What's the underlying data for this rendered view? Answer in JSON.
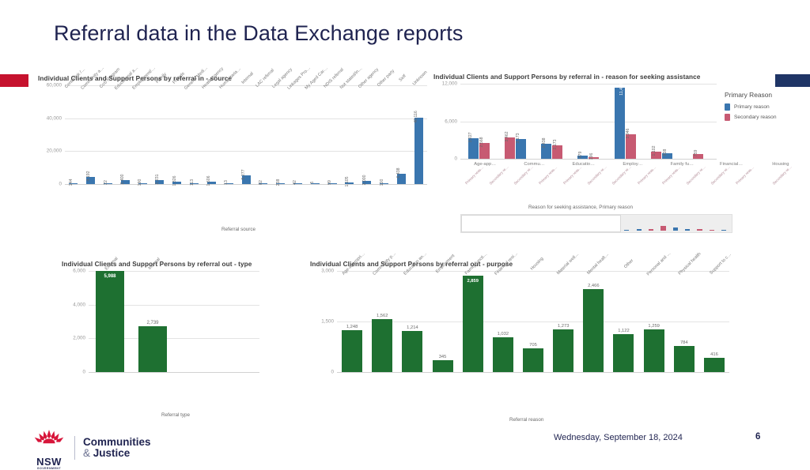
{
  "slide": {
    "title": "Referral data in the Data Exchange reports",
    "page_number": "6",
    "date": "Wednesday, September 18, 2024",
    "accent_red": "#c6122e",
    "accent_navy": "#1f3566"
  },
  "footer": {
    "org_line1": "NSW",
    "org_line2": "GOVERNMENT",
    "dept_line1": "Communities",
    "dept_amp": "&",
    "dept_line2": "Justice"
  },
  "chart_data": [
    {
      "id": "referral-in-source",
      "type": "bar",
      "title": "Individual Clients and Support Persons by referral in - source",
      "xlabel": "Referral source",
      "ylabel": "",
      "ylim": [
        0,
        60000
      ],
      "yticks": [
        "0",
        "20,000",
        "40,000",
        "60,000"
      ],
      "grid": true,
      "color": "#3a76af",
      "categories": [
        "Centrelink /…",
        "Community a…",
        "CoS Program",
        "Educational a…",
        "Employment/…",
        "Family",
        "Friends",
        "General Medi…",
        "Health Agency",
        "Humanitaria…",
        "Internal",
        "LAC referral",
        "Legal agency",
        "Linkages Pro…",
        "My Aged Car…",
        "NDIS referral",
        "Not stated/in…",
        "Other agency",
        "Other party",
        "Self",
        "Unknown"
      ],
      "values": [
        144,
        4192,
        22,
        2400,
        190,
        2231,
        1326,
        113,
        1606,
        13,
        5277,
        82,
        238,
        42,
        5,
        99,
        1105,
        2000,
        100,
        6438,
        40116
      ],
      "value_labels": [
        "144",
        "4,192",
        "22",
        "2,400",
        "190",
        "2,231",
        "1,326",
        "113",
        "1,606",
        "13",
        "5,277",
        "82",
        "238",
        "42",
        "5",
        "99",
        "1,105",
        "2,000",
        "100",
        "6,438",
        "40,116"
      ]
    },
    {
      "id": "referral-in-reason",
      "type": "bar",
      "title": "Individual Clients and Support Persons by referral in - reason for seeking assistance",
      "xlabel": "Reason for seeking assistance, Primary reason",
      "ylabel": "",
      "ylim": [
        0,
        12000
      ],
      "yticks": [
        "0",
        "6,000",
        "12,000"
      ],
      "grid": true,
      "legend_title": "Primary Reason",
      "legend_position": "right",
      "legend": [
        {
          "name": "Primary reason",
          "color": "#3a76af"
        },
        {
          "name": "Secondary reason",
          "color": "#c75a72"
        }
      ],
      "categories": [
        "Age-app…",
        "Commu…",
        "Educatio…",
        "Employ…",
        "Family fu…",
        "Financial…",
        "Housing"
      ],
      "groups": [
        {
          "category": "Age-app…",
          "bars": [
            {
              "series": "Primary reason",
              "sublabel": "Primary reas…",
              "value": 3227,
              "label": "3,227",
              "color": "#3a76af"
            },
            {
              "series": "Secondary reason",
              "sublabel": "Secondary re…",
              "value": 2568,
              "label": "2,568",
              "color": "#c75a72"
            }
          ]
        },
        {
          "category": "Commu…",
          "bars": [
            {
              "series": "Secondary reason",
              "sublabel": "Secondary re…",
              "value": 3462,
              "label": "3,462",
              "color": "#c75a72"
            },
            {
              "series": "Primary reason",
              "sublabel": "Primary reas…",
              "value": 3173,
              "label": "3,173",
              "color": "#3a76af"
            }
          ]
        },
        {
          "category": "Educatio…",
          "bars": [
            {
              "series": "Primary reason",
              "sublabel": "Primary reas…",
              "value": 2438,
              "label": "2,438",
              "color": "#3a76af"
            },
            {
              "series": "Secondary reason",
              "sublabel": "Secondary re…",
              "value": 2173,
              "label": "2,173",
              "color": "#c75a72"
            }
          ]
        },
        {
          "category": "Employ…",
          "bars": [
            {
              "series": "Secondary reason",
              "sublabel": "Secondary re…",
              "value": 479,
              "label": "479",
              "color": "#3a76af"
            },
            {
              "series": "Primary reason",
              "sublabel": "Primary reas…",
              "value": 196,
              "label": "196",
              "color": "#c75a72"
            }
          ]
        },
        {
          "category": "Family fu…",
          "bars": [
            {
              "series": "Primary reason",
              "sublabel": "Primary reas…",
              "value": 11417,
              "label": "11,417",
              "color": "#3a76af"
            },
            {
              "series": "Secondary reason",
              "sublabel": "Secondary re…",
              "value": 3946,
              "label": "3,946",
              "color": "#c75a72"
            }
          ]
        },
        {
          "category": "Financial…",
          "bars": [
            {
              "series": "Secondary reason",
              "sublabel": "Secondary re…",
              "value": 1102,
              "label": "1,102",
              "color": "#c75a72"
            },
            {
              "series": "Primary reason",
              "sublabel": "Primary reas…",
              "value": 838,
              "label": "838",
              "color": "#3a76af"
            }
          ]
        },
        {
          "category": "Housing",
          "bars": [
            {
              "series": "Secondary reason",
              "sublabel": "Secondary re…",
              "value": 759,
              "label": "759",
              "color": "#c75a72"
            }
          ]
        }
      ],
      "minimap": {
        "window_fraction": 0.59,
        "values": [
          {
            "v": 3227,
            "c": "#3a76af"
          },
          {
            "v": 2568,
            "c": "#c75a72"
          },
          {
            "v": 3462,
            "c": "#c75a72"
          },
          {
            "v": 3173,
            "c": "#3a76af"
          },
          {
            "v": 2438,
            "c": "#3a76af"
          },
          {
            "v": 2173,
            "c": "#c75a72"
          },
          {
            "v": 479,
            "c": "#3a76af"
          },
          {
            "v": 196,
            "c": "#c75a72"
          },
          {
            "v": 11417,
            "c": "#3a76af"
          },
          {
            "v": 3946,
            "c": "#c75a72"
          },
          {
            "v": 1102,
            "c": "#c75a72"
          },
          {
            "v": 838,
            "c": "#3a76af"
          },
          {
            "v": 759,
            "c": "#c75a72"
          },
          {
            "v": 420,
            "c": "#3a76af"
          },
          {
            "v": 1500,
            "c": "#3a76af"
          },
          {
            "v": 1300,
            "c": "#c75a72"
          },
          {
            "v": 3600,
            "c": "#c75a72"
          },
          {
            "v": 2600,
            "c": "#3a76af"
          },
          {
            "v": 1500,
            "c": "#3a76af"
          },
          {
            "v": 1250,
            "c": "#c75a72"
          },
          {
            "v": 700,
            "c": "#c75a72"
          },
          {
            "v": 500,
            "c": "#3a76af"
          }
        ]
      }
    },
    {
      "id": "referral-out-type",
      "type": "bar",
      "title": "Individual Clients and Support Persons by referral out - type",
      "xlabel": "Referral type",
      "ylabel": "",
      "ylim": [
        0,
        6000
      ],
      "yticks": [
        "0",
        "2,000",
        "4,000",
        "6,000"
      ],
      "grid": true,
      "color": "#1e7031",
      "categories": [
        "External",
        "Internal"
      ],
      "values": [
        5988,
        2739
      ],
      "value_labels": [
        "5,988",
        "2,739"
      ]
    },
    {
      "id": "referral-out-purpose",
      "type": "bar",
      "title": "Individual Clients and Support Persons by referral out - purpose",
      "xlabel": "Referral reason",
      "ylabel": "",
      "ylim": [
        0,
        3000
      ],
      "yticks": [
        "0",
        "1,500",
        "3,000"
      ],
      "grid": true,
      "color": "#1e7031",
      "categories": [
        "Age-appropri…",
        "Community p…",
        "Education an…",
        "Employment",
        "Family functi…",
        "Financial resi…",
        "Housing",
        "Material well…",
        "Mental healt…",
        "Other",
        "Personal and …",
        "Physical health",
        "Support to c…"
      ],
      "values": [
        1248,
        1562,
        1214,
        345,
        2859,
        1032,
        705,
        1273,
        2466,
        1122,
        1259,
        784,
        416
      ],
      "value_labels": [
        "1,248",
        "1,562",
        "1,214",
        "345",
        "2,859",
        "1,032",
        "705",
        "1,273",
        "2,466",
        "1,122",
        "1,259",
        "784",
        "416"
      ]
    }
  ]
}
